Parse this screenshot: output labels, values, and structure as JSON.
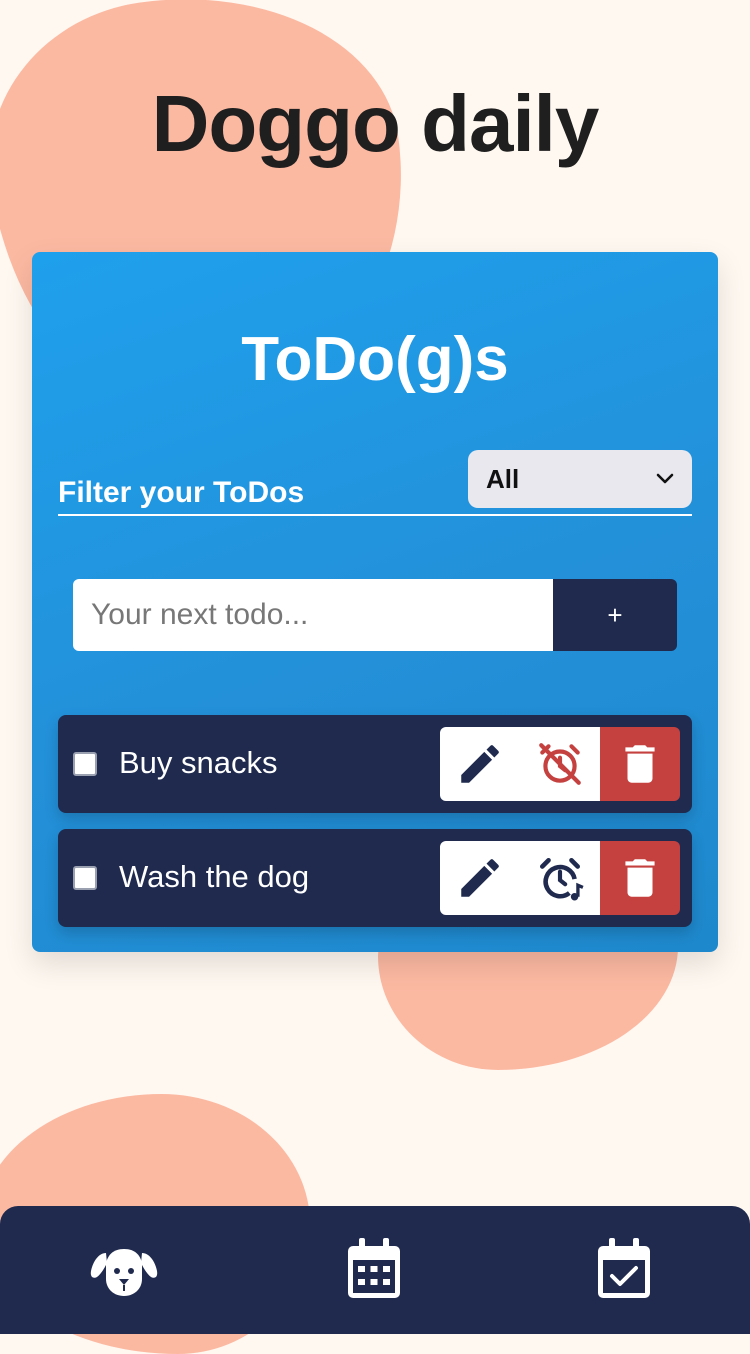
{
  "app": {
    "title": "Doggo daily"
  },
  "card": {
    "title": "ToDo(g)s",
    "filter": {
      "label": "Filter your ToDos",
      "selected": "All"
    },
    "add": {
      "placeholder": "Your next todo...",
      "button_label": "+"
    }
  },
  "todos": [
    {
      "text": "Buy snacks",
      "checked": false,
      "alarm": "alarm-off-icon"
    },
    {
      "text": "Wash the dog",
      "checked": false,
      "alarm": "alarm-music-icon"
    }
  ],
  "nav": {
    "items": [
      "dog-icon",
      "calendar-icon",
      "calendar-check-icon"
    ]
  },
  "colors": {
    "background": "#fff8f1",
    "blob": "#fcb9a2",
    "card": "#2396df",
    "navy": "#1f2a4e",
    "delete": "#c4413f"
  }
}
